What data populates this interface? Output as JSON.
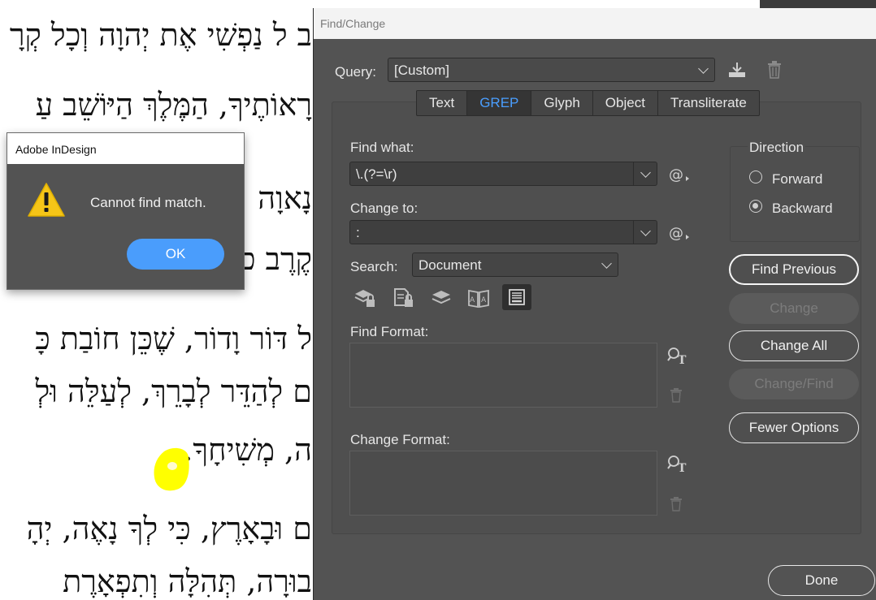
{
  "document": {
    "lines": [
      "ב ל נַפְשִׁי אֶת יְהוָה וְכָל קְרָ",
      "רָאוֹתֶיךָ, הַמֶּלֶךְ הַיּוֹשֵׁב עַ",
      "נָאוָה",
      "קֶרֶב כ",
      "ל דּוֹר וָדוֹר, שֶׁכֵּן חוֹבַת כָּ",
      "ם לְהַדֵּר לְבָרֵךְ, לְעַלֵּה וּלְ",
      "ה, מְשִׁיחָךָ.",
      "ם וּבָאָרֶץ, כִּי לְךָ נָאֶה, יְהָ",
      "בוּרָה, תְּהִלָּה וְתִפְאָרֶת"
    ]
  },
  "find_change": {
    "title": "Find/Change",
    "query_label": "Query:",
    "query_value": "[Custom]",
    "tabs": [
      "Text",
      "GREP",
      "Glyph",
      "Object",
      "Transliterate"
    ],
    "active_tab": "GREP",
    "find_what_label": "Find what:",
    "find_what_value": "\\.(?=\\r)",
    "change_to_label": "Change to:",
    "change_to_value": ":",
    "search_label": "Search:",
    "search_value": "Document",
    "find_format_label": "Find Format:",
    "change_format_label": "Change Format:",
    "direction_label": "Direction",
    "direction_forward": "Forward",
    "direction_backward": "Backward",
    "direction_selected": "Backward",
    "buttons": {
      "find_previous": "Find Previous",
      "change": "Change",
      "change_all": "Change All",
      "change_find": "Change/Find",
      "fewer_options": "Fewer Options",
      "done": "Done"
    }
  },
  "alert": {
    "title": "Adobe InDesign",
    "message": "Cannot find match.",
    "ok": "OK"
  },
  "colors": {
    "dialog_bg": "#535353",
    "accent": "#4a9dfc",
    "highlight": "#ffff00",
    "warning": "#f5c518"
  },
  "icons": [
    "save-query-icon",
    "delete-query-icon",
    "special-characters-icon",
    "lock-layers-icon",
    "lock-stories-icon",
    "hidden-layers-icon",
    "master-pages-icon",
    "footnotes-icon",
    "find-format-icon",
    "clear-format-icon",
    "warning-icon"
  ]
}
